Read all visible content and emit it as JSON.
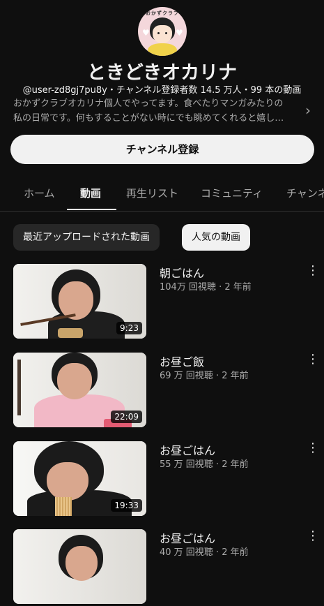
{
  "channel": {
    "name": "ときどきオカリナ",
    "meta": "@user-zd8gj7pu8y・チャンネル登録者数 14.5 万人・99 本の動画",
    "description_line1": "おかずクラブオカリナ個人でやってます。食べたりマンガみたりの",
    "description_line2": "私の日常です。何もすることがない時にでも眺めてくれると嬉し…",
    "avatar_text": "おかずクラブ"
  },
  "subscribe_label": "チャンネル登録",
  "tabs": [
    {
      "label": "ホーム"
    },
    {
      "label": "動画"
    },
    {
      "label": "再生リスト"
    },
    {
      "label": "コミュニティ"
    },
    {
      "label": "チャンネル"
    }
  ],
  "filters": {
    "recent": "最近アップロードされた動画",
    "popular": "人気の動画"
  },
  "videos": [
    {
      "title": "朝ごはん",
      "meta": "104万 回視聴 · 2 年前",
      "duration": "9:23"
    },
    {
      "title": "お昼ご飯",
      "meta": "69 万 回視聴 · 2 年前",
      "duration": "22:09"
    },
    {
      "title": "お昼ごはん",
      "meta": "55 万 回視聴 · 2 年前",
      "duration": "19:33"
    },
    {
      "title": "お昼ごはん",
      "meta": "40 万 回視聴 · 2 年前",
      "duration": ""
    }
  ],
  "icons": {
    "more": "more-vert-icon",
    "chevron": "chevron-right-icon"
  }
}
